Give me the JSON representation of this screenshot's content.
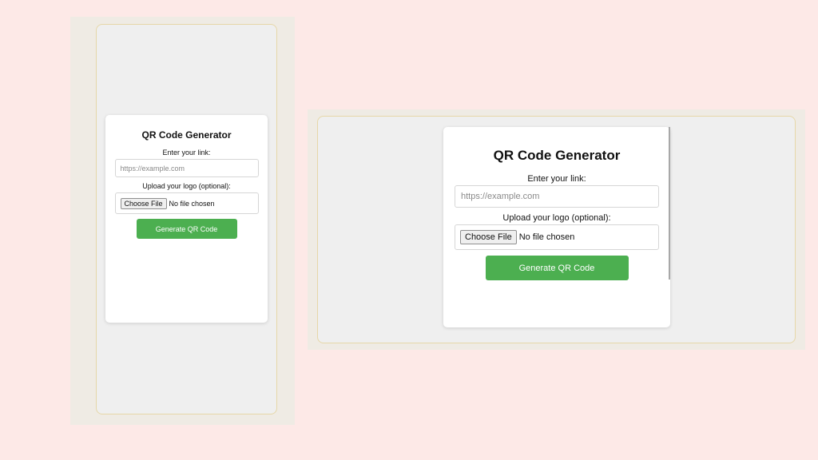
{
  "colors": {
    "page_background": "#fde9e7",
    "frame_background": "#efebe4",
    "viewport_background": "#efefef",
    "card_background": "#ffffff",
    "button_green": "#4caf50",
    "button_text": "#ffffff"
  },
  "mobile": {
    "title": "QR Code Generator",
    "link_label": "Enter your link:",
    "link_placeholder": "https://example.com",
    "link_value": "",
    "logo_label": "Upload your logo (optional):",
    "file_button_label": "Choose File",
    "file_status": "No file chosen",
    "generate_label": "Generate QR Code"
  },
  "desktop": {
    "title": "QR Code Generator",
    "link_label": "Enter your link:",
    "link_placeholder": "https://example.com",
    "link_value": "",
    "logo_label": "Upload your logo (optional):",
    "file_button_label": "Choose File",
    "file_status": "No file chosen",
    "generate_label": "Generate QR Code"
  }
}
